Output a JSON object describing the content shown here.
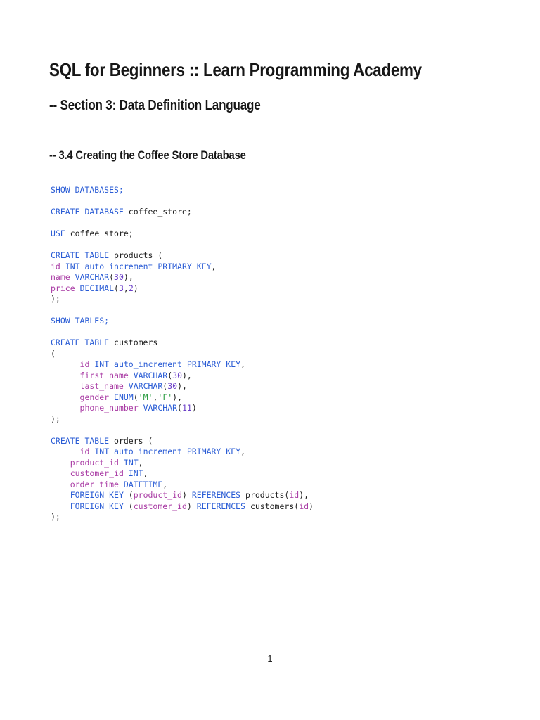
{
  "page": {
    "title": "SQL for Beginners :: Learn Programming Academy",
    "section_heading": "-- Section 3: Data Definition Language",
    "subsection_heading": "-- 3.4 Creating the Coffee Store Database",
    "page_number": "1"
  },
  "syntax_colors": {
    "keyword": "#2a5cd5",
    "identifier": "#a93ba4",
    "number": "#6b3fc8",
    "string": "#2e9e44",
    "plain": "#1b1b1b"
  },
  "code_lines": [
    [
      {
        "t": "SHOW DATABASES;",
        "c": "keyword"
      }
    ],
    [],
    [
      {
        "t": "CREATE DATABASE",
        "c": "keyword"
      },
      {
        "t": " coffee_store;",
        "c": "plain"
      }
    ],
    [],
    [
      {
        "t": "USE",
        "c": "keyword"
      },
      {
        "t": " coffee_store;",
        "c": "plain"
      }
    ],
    [],
    [
      {
        "t": "CREATE TABLE",
        "c": "keyword"
      },
      {
        "t": " products (",
        "c": "plain"
      }
    ],
    [
      {
        "t": "id",
        "c": "identifier"
      },
      {
        "t": " ",
        "c": "plain"
      },
      {
        "t": "INT auto_increment PRIMARY KEY",
        "c": "keyword"
      },
      {
        "t": ",",
        "c": "plain"
      }
    ],
    [
      {
        "t": "name",
        "c": "identifier"
      },
      {
        "t": " ",
        "c": "plain"
      },
      {
        "t": "VARCHAR",
        "c": "keyword"
      },
      {
        "t": "(",
        "c": "plain"
      },
      {
        "t": "30",
        "c": "number"
      },
      {
        "t": "),",
        "c": "plain"
      }
    ],
    [
      {
        "t": "price",
        "c": "identifier"
      },
      {
        "t": " ",
        "c": "plain"
      },
      {
        "t": "DECIMAL",
        "c": "keyword"
      },
      {
        "t": "(",
        "c": "plain"
      },
      {
        "t": "3",
        "c": "number"
      },
      {
        "t": ",",
        "c": "plain"
      },
      {
        "t": "2",
        "c": "number"
      },
      {
        "t": ")",
        "c": "plain"
      }
    ],
    [
      {
        "t": ");",
        "c": "plain"
      }
    ],
    [],
    [
      {
        "t": "SHOW TABLES;",
        "c": "keyword"
      }
    ],
    [],
    [
      {
        "t": "CREATE TABLE",
        "c": "keyword"
      },
      {
        "t": " customers",
        "c": "plain"
      }
    ],
    [
      {
        "t": "(",
        "c": "plain"
      }
    ],
    [
      {
        "t": "      ",
        "c": "plain"
      },
      {
        "t": "id",
        "c": "identifier"
      },
      {
        "t": " ",
        "c": "plain"
      },
      {
        "t": "INT auto_increment PRIMARY KEY",
        "c": "keyword"
      },
      {
        "t": ",",
        "c": "plain"
      }
    ],
    [
      {
        "t": "      ",
        "c": "plain"
      },
      {
        "t": "first_name",
        "c": "identifier"
      },
      {
        "t": " ",
        "c": "plain"
      },
      {
        "t": "VARCHAR",
        "c": "keyword"
      },
      {
        "t": "(",
        "c": "plain"
      },
      {
        "t": "30",
        "c": "number"
      },
      {
        "t": "),",
        "c": "plain"
      }
    ],
    [
      {
        "t": "      ",
        "c": "plain"
      },
      {
        "t": "last_name",
        "c": "identifier"
      },
      {
        "t": " ",
        "c": "plain"
      },
      {
        "t": "VARCHAR",
        "c": "keyword"
      },
      {
        "t": "(",
        "c": "plain"
      },
      {
        "t": "30",
        "c": "number"
      },
      {
        "t": "),",
        "c": "plain"
      }
    ],
    [
      {
        "t": "      ",
        "c": "plain"
      },
      {
        "t": "gender",
        "c": "identifier"
      },
      {
        "t": " ",
        "c": "plain"
      },
      {
        "t": "ENUM",
        "c": "keyword"
      },
      {
        "t": "(",
        "c": "plain"
      },
      {
        "t": "'M'",
        "c": "string"
      },
      {
        "t": ",",
        "c": "plain"
      },
      {
        "t": "'F'",
        "c": "string"
      },
      {
        "t": "),",
        "c": "plain"
      }
    ],
    [
      {
        "t": "      ",
        "c": "plain"
      },
      {
        "t": "phone_number",
        "c": "identifier"
      },
      {
        "t": " ",
        "c": "plain"
      },
      {
        "t": "VARCHAR",
        "c": "keyword"
      },
      {
        "t": "(",
        "c": "plain"
      },
      {
        "t": "11",
        "c": "number"
      },
      {
        "t": ")",
        "c": "plain"
      }
    ],
    [
      {
        "t": ");",
        "c": "plain"
      }
    ],
    [],
    [
      {
        "t": "CREATE TABLE",
        "c": "keyword"
      },
      {
        "t": " orders (",
        "c": "plain"
      }
    ],
    [
      {
        "t": "      ",
        "c": "plain"
      },
      {
        "t": "id",
        "c": "identifier"
      },
      {
        "t": " ",
        "c": "plain"
      },
      {
        "t": "INT auto_increment PRIMARY KEY",
        "c": "keyword"
      },
      {
        "t": ",",
        "c": "plain"
      }
    ],
    [
      {
        "t": "    ",
        "c": "plain"
      },
      {
        "t": "product_id",
        "c": "identifier"
      },
      {
        "t": " ",
        "c": "plain"
      },
      {
        "t": "INT",
        "c": "keyword"
      },
      {
        "t": ",",
        "c": "plain"
      }
    ],
    [
      {
        "t": "    ",
        "c": "plain"
      },
      {
        "t": "customer_id",
        "c": "identifier"
      },
      {
        "t": " ",
        "c": "plain"
      },
      {
        "t": "INT",
        "c": "keyword"
      },
      {
        "t": ",",
        "c": "plain"
      }
    ],
    [
      {
        "t": "    ",
        "c": "plain"
      },
      {
        "t": "order_time",
        "c": "identifier"
      },
      {
        "t": " ",
        "c": "plain"
      },
      {
        "t": "DATETIME",
        "c": "keyword"
      },
      {
        "t": ",",
        "c": "plain"
      }
    ],
    [
      {
        "t": "    ",
        "c": "plain"
      },
      {
        "t": "FOREIGN KEY",
        "c": "keyword"
      },
      {
        "t": " (",
        "c": "plain"
      },
      {
        "t": "product_id",
        "c": "identifier"
      },
      {
        "t": ") ",
        "c": "plain"
      },
      {
        "t": "REFERENCES",
        "c": "keyword"
      },
      {
        "t": " products(",
        "c": "plain"
      },
      {
        "t": "id",
        "c": "identifier"
      },
      {
        "t": "),",
        "c": "plain"
      }
    ],
    [
      {
        "t": "    ",
        "c": "plain"
      },
      {
        "t": "FOREIGN KEY",
        "c": "keyword"
      },
      {
        "t": " (",
        "c": "plain"
      },
      {
        "t": "customer_id",
        "c": "identifier"
      },
      {
        "t": ") ",
        "c": "plain"
      },
      {
        "t": "REFERENCES",
        "c": "keyword"
      },
      {
        "t": " customers(",
        "c": "plain"
      },
      {
        "t": "id",
        "c": "identifier"
      },
      {
        "t": ")",
        "c": "plain"
      }
    ],
    [
      {
        "t": ");",
        "c": "plain"
      }
    ]
  ]
}
